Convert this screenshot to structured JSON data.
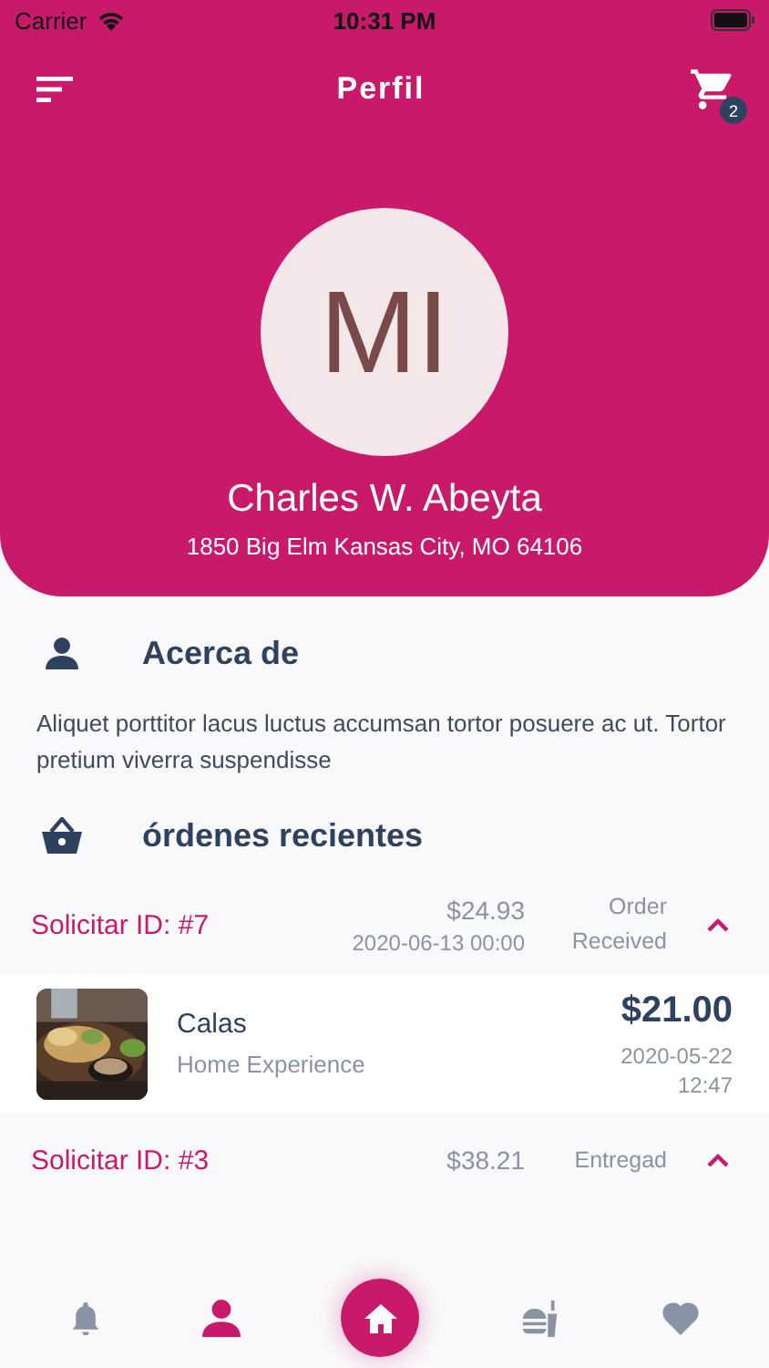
{
  "status_bar": {
    "carrier": "Carrier",
    "time": "10:31 PM"
  },
  "header": {
    "title": "Perfil",
    "cart_count": "2"
  },
  "profile": {
    "initials": "MI",
    "name": "Charles W. Abeyta",
    "address": "1850 Big Elm Kansas City, MO 64106"
  },
  "about": {
    "title": "Acerca de",
    "text": "Aliquet porttitor lacus luctus accumsan tortor posuere ac ut. Tortor pretium viverra suspendisse"
  },
  "orders_title": "órdenes recientes",
  "orders": [
    {
      "id": "Solicitar ID: #7",
      "total": "$24.93",
      "date": "2020-06-13 00:00",
      "status": "Order Received",
      "expanded": true,
      "items": [
        {
          "name": "Calas",
          "subtitle": "Home Experience",
          "price": "$21.00",
          "date": "2020-05-22",
          "time": "12:47"
        }
      ]
    },
    {
      "id": "Solicitar ID: #3",
      "total": "$38.21",
      "status": "Entregad",
      "expanded": true
    }
  ],
  "nav": [
    {
      "kind": "bell",
      "selected": false
    },
    {
      "kind": "person",
      "selected": true
    },
    {
      "kind": "home",
      "selected": false
    },
    {
      "kind": "food",
      "selected": false
    },
    {
      "kind": "heart",
      "selected": false
    }
  ]
}
